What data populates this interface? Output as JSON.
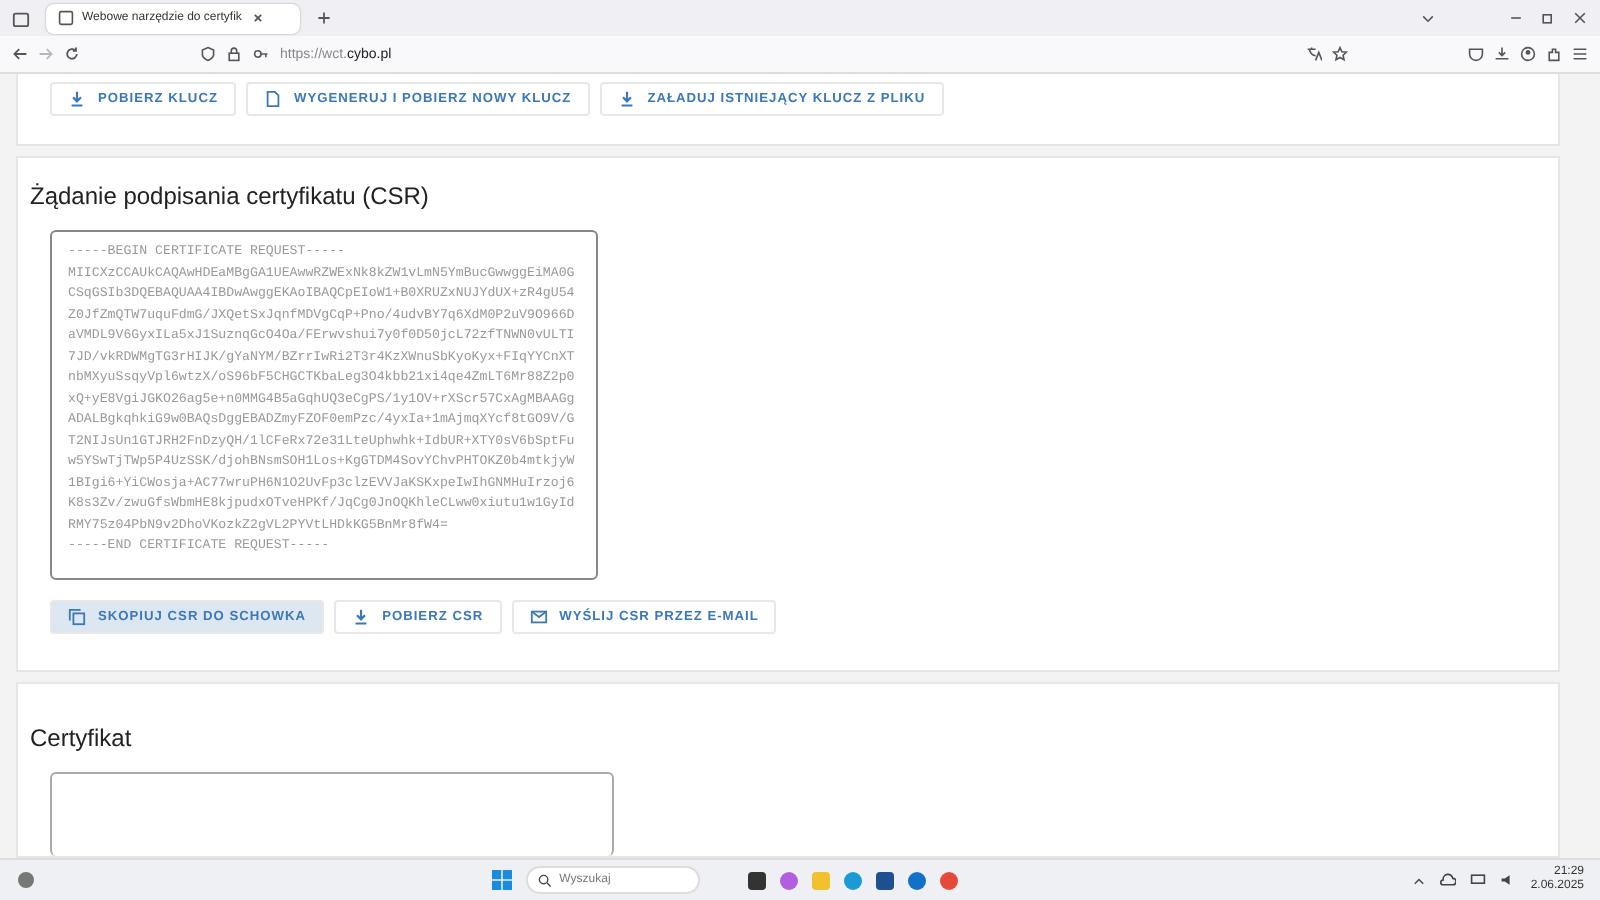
{
  "browser": {
    "tab_title": "Webowe narzędzie do certyfik",
    "url_prefix": "https://wct.",
    "url_domain": "cybo.pl"
  },
  "key_actions": [
    {
      "label": "POBIERZ KLUCZ",
      "kind": "download",
      "hovered": false
    },
    {
      "label": "WYGENERUJ I POBIERZ NOWY KLUCZ",
      "kind": "generate",
      "hovered": false
    },
    {
      "label": "ZAŁADUJ ISTNIEJĄCY KLUCZ Z PLIKU",
      "kind": "upload",
      "hovered": false
    }
  ],
  "csr": {
    "title": "Żądanie podpisania certyfikatu (CSR)",
    "value": "-----BEGIN CERTIFICATE REQUEST-----\nMIICXzCCAUkCAQAwHDEaMBgGA1UEAwwRZWExNk8kZW1vLmN5YmBucGwwggEiMA0G\nCSqGSIb3DQEBAQUAA4IBDwAwggEKAoIBAQCpEIoW1+B0XRUZxNUJYdUX+zR4gU54\nZ0JfZmQTW7uquFdmG/JXQetSxJqnfMDVgCqP+Pno/4udvBY7q6XdM0P2uV9O966D\naVMDL9V6GyxILa5xJ1SuznqGcO4Oa/FErwvshui7y0f0D50jcL72zfTNWN0vULTI\n7JD/vkRDWMgTG3rHIJK/gYaNYM/BZrrIwRi2T3r4KzXWnuSbKyoKyx+FIqYYCnXT\nnbMXyuSsqyVpl6wtzX/oS96bF5CHGCTKbaLeg3O4kbb21xi4qe4ZmLT6Mr88Z2p0\nxQ+yE8VgiJGKO26ag5e+n0MMG4B5aGqhUQ3eCgPS/1y1OV+rXScr57CxAgMBAAGg\nADALBgkqhkiG9w0BAQsDggEBADZmyFZOF0emPzc/4yxIa+1mAjmqXYcf8tGO9V/G\nT2NIJsUn1GTJRH2FnDzyQH/1lCFeRx72e31LteUphwhk+IdbUR+XTY0sV6bSptFu\nw5YSwTjTWp5P4UzSSK/djohBNsmSOH1Los+KgGTDM4SovYChvPHTOKZ0b4mtkjyW\n1BIgi6+YiCWosja+AC77wruPH6N1O2UvFp3clzEVVJaKSKxpeIwIhGNMHuIrzoj6\nK8s3Zv/zwuGfsWbmHE8kjpudxOTveHPKf/JqCg0JnOQKhleCLww0xiutu1w1GyId\nRMY75z04PbN9v2DhoVKozkZ2gVL2PYVtLHDkKG5BnMr8fW4=\n-----END CERTIFICATE REQUEST-----"
  },
  "csr_actions": [
    {
      "label": "SKOPIUJ CSR DO SCHOWKA",
      "kind": "copy",
      "hovered": true
    },
    {
      "label": "POBIERZ CSR",
      "kind": "download",
      "hovered": false
    },
    {
      "label": "WYŚLIJ CSR PRZEZ E-MAIL",
      "kind": "email",
      "hovered": false
    }
  ],
  "certificate": {
    "title": "Certyfikat"
  },
  "taskbar": {
    "search_placeholder": "Wyszukaj",
    "time": "21:29",
    "date": "2.06.2025"
  }
}
